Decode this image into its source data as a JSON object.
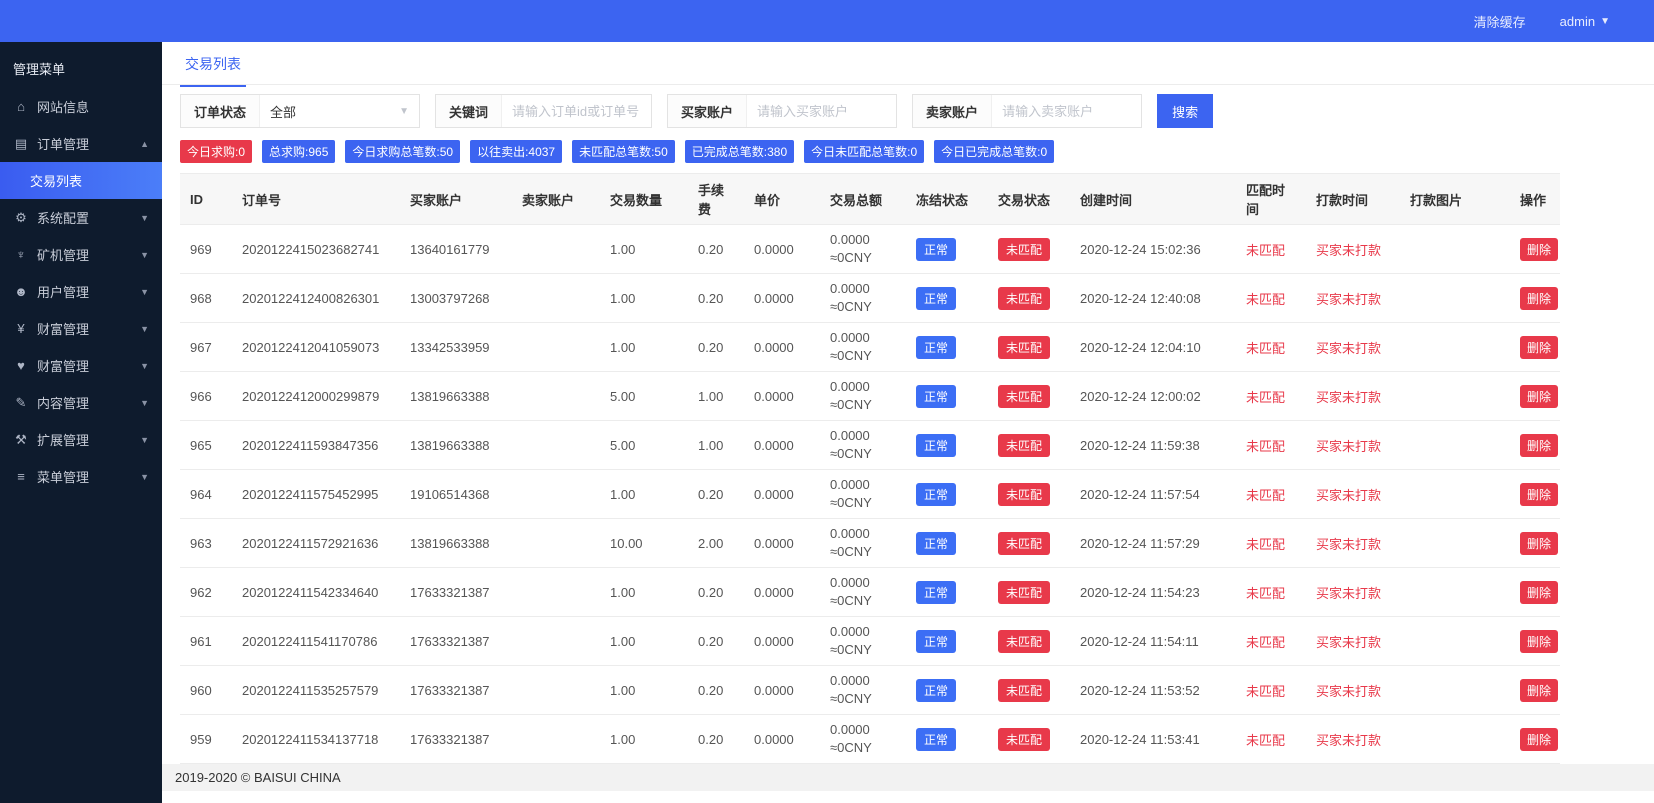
{
  "colors": {
    "primary_blue": "#3c64f1",
    "badge_red": "#e8394a",
    "sidebar_bg": "#0e1b2d"
  },
  "topbar": {
    "clear_cache": "清除缓存",
    "username": "admin"
  },
  "sidebar": {
    "header": "管理菜单",
    "items": [
      {
        "key": "website-info",
        "label": "网站信息",
        "icon": "home-icon"
      },
      {
        "key": "order-management",
        "label": "订单管理",
        "icon": "orders-icon",
        "arrow": "up"
      },
      {
        "key": "trade-list",
        "label": "交易列表",
        "submenu": true,
        "active": true
      },
      {
        "key": "system-config",
        "label": "系统配置",
        "icon": "gear-icon",
        "arrow": "down"
      },
      {
        "key": "miner-management",
        "label": "矿机管理",
        "icon": "miner-icon",
        "arrow": "down"
      },
      {
        "key": "user-management",
        "label": "用户管理",
        "icon": "users-icon",
        "arrow": "down"
      },
      {
        "key": "wealth-management",
        "label": "财富管理",
        "icon": "money-icon",
        "arrow": "down"
      },
      {
        "key": "wealth-management-2",
        "label": "财富管理",
        "icon": "heart-icon",
        "arrow": "down"
      },
      {
        "key": "content-management",
        "label": "内容管理",
        "icon": "document-icon",
        "arrow": "down"
      },
      {
        "key": "extension-management",
        "label": "扩展管理",
        "icon": "wrench-icon",
        "arrow": "down"
      },
      {
        "key": "menu-management",
        "label": "菜单管理",
        "icon": "menu-icon",
        "arrow": "down"
      }
    ]
  },
  "tabs": {
    "active": "交易列表"
  },
  "filters": {
    "order_status": {
      "label": "订单状态",
      "value": "全部"
    },
    "keyword": {
      "label": "关键词",
      "placeholder": "请输入订单id或订单号"
    },
    "buyer": {
      "label": "买家账户",
      "placeholder": "请输入买家账户"
    },
    "seller": {
      "label": "卖家账户",
      "placeholder": "请输入卖家账户"
    },
    "search_button": "搜索"
  },
  "stats": [
    {
      "label": "今日求购:0",
      "color": "red"
    },
    {
      "label": "总求购:965",
      "color": "blue"
    },
    {
      "label": "今日求购总笔数:50",
      "color": "blue"
    },
    {
      "label": "以往卖出:4037",
      "color": "blue"
    },
    {
      "label": "未匹配总笔数:50",
      "color": "blue"
    },
    {
      "label": "已完成总笔数:380",
      "color": "blue"
    },
    {
      "label": "今日未匹配总笔数:0",
      "color": "blue"
    },
    {
      "label": "今日已完成总笔数:0",
      "color": "blue"
    }
  ],
  "table": {
    "columns": [
      "ID",
      "订单号",
      "买家账户",
      "卖家账户",
      "交易数量",
      "手续费",
      "单价",
      "交易总额",
      "冻结状态",
      "交易状态",
      "创建时间",
      "匹配时间",
      "打款时间",
      "打款图片",
      "操作"
    ],
    "action_label": "删除",
    "rows": [
      {
        "id": "969",
        "order_no": "2020122415023682741",
        "buyer": "13640161779",
        "seller": "",
        "qty": "1.00",
        "fee": "0.20",
        "price": "0.0000",
        "total_line1": "0.0000",
        "total_line2": "≈0CNY",
        "freeze_status": "正常",
        "trade_status": "未匹配",
        "created": "2020-12-24 15:02:36",
        "match_time": "未匹配",
        "pay_time": "买家未打款",
        "pay_image": ""
      },
      {
        "id": "968",
        "order_no": "2020122412400826301",
        "buyer": "13003797268",
        "seller": "",
        "qty": "1.00",
        "fee": "0.20",
        "price": "0.0000",
        "total_line1": "0.0000",
        "total_line2": "≈0CNY",
        "freeze_status": "正常",
        "trade_status": "未匹配",
        "created": "2020-12-24 12:40:08",
        "match_time": "未匹配",
        "pay_time": "买家未打款",
        "pay_image": ""
      },
      {
        "id": "967",
        "order_no": "2020122412041059073",
        "buyer": "13342533959",
        "seller": "",
        "qty": "1.00",
        "fee": "0.20",
        "price": "0.0000",
        "total_line1": "0.0000",
        "total_line2": "≈0CNY",
        "freeze_status": "正常",
        "trade_status": "未匹配",
        "created": "2020-12-24 12:04:10",
        "match_time": "未匹配",
        "pay_time": "买家未打款",
        "pay_image": ""
      },
      {
        "id": "966",
        "order_no": "2020122412000299879",
        "buyer": "13819663388",
        "seller": "",
        "qty": "5.00",
        "fee": "1.00",
        "price": "0.0000",
        "total_line1": "0.0000",
        "total_line2": "≈0CNY",
        "freeze_status": "正常",
        "trade_status": "未匹配",
        "created": "2020-12-24 12:00:02",
        "match_time": "未匹配",
        "pay_time": "买家未打款",
        "pay_image": ""
      },
      {
        "id": "965",
        "order_no": "2020122411593847356",
        "buyer": "13819663388",
        "seller": "",
        "qty": "5.00",
        "fee": "1.00",
        "price": "0.0000",
        "total_line1": "0.0000",
        "total_line2": "≈0CNY",
        "freeze_status": "正常",
        "trade_status": "未匹配",
        "created": "2020-12-24 11:59:38",
        "match_time": "未匹配",
        "pay_time": "买家未打款",
        "pay_image": ""
      },
      {
        "id": "964",
        "order_no": "2020122411575452995",
        "buyer": "19106514368",
        "seller": "",
        "qty": "1.00",
        "fee": "0.20",
        "price": "0.0000",
        "total_line1": "0.0000",
        "total_line2": "≈0CNY",
        "freeze_status": "正常",
        "trade_status": "未匹配",
        "created": "2020-12-24 11:57:54",
        "match_time": "未匹配",
        "pay_time": "买家未打款",
        "pay_image": ""
      },
      {
        "id": "963",
        "order_no": "2020122411572921636",
        "buyer": "13819663388",
        "seller": "",
        "qty": "10.00",
        "fee": "2.00",
        "price": "0.0000",
        "total_line1": "0.0000",
        "total_line2": "≈0CNY",
        "freeze_status": "正常",
        "trade_status": "未匹配",
        "created": "2020-12-24 11:57:29",
        "match_time": "未匹配",
        "pay_time": "买家未打款",
        "pay_image": ""
      },
      {
        "id": "962",
        "order_no": "2020122411542334640",
        "buyer": "17633321387",
        "seller": "",
        "qty": "1.00",
        "fee": "0.20",
        "price": "0.0000",
        "total_line1": "0.0000",
        "total_line2": "≈0CNY",
        "freeze_status": "正常",
        "trade_status": "未匹配",
        "created": "2020-12-24 11:54:23",
        "match_time": "未匹配",
        "pay_time": "买家未打款",
        "pay_image": ""
      },
      {
        "id": "961",
        "order_no": "2020122411541170786",
        "buyer": "17633321387",
        "seller": "",
        "qty": "1.00",
        "fee": "0.20",
        "price": "0.0000",
        "total_line1": "0.0000",
        "total_line2": "≈0CNY",
        "freeze_status": "正常",
        "trade_status": "未匹配",
        "created": "2020-12-24 11:54:11",
        "match_time": "未匹配",
        "pay_time": "买家未打款",
        "pay_image": ""
      },
      {
        "id": "960",
        "order_no": "2020122411535257579",
        "buyer": "17633321387",
        "seller": "",
        "qty": "1.00",
        "fee": "0.20",
        "price": "0.0000",
        "total_line1": "0.0000",
        "total_line2": "≈0CNY",
        "freeze_status": "正常",
        "trade_status": "未匹配",
        "created": "2020-12-24 11:53:52",
        "match_time": "未匹配",
        "pay_time": "买家未打款",
        "pay_image": ""
      },
      {
        "id": "959",
        "order_no": "2020122411534137718",
        "buyer": "17633321387",
        "seller": "",
        "qty": "1.00",
        "fee": "0.20",
        "price": "0.0000",
        "total_line1": "0.0000",
        "total_line2": "≈0CNY",
        "freeze_status": "正常",
        "trade_status": "未匹配",
        "created": "2020-12-24 11:53:41",
        "match_time": "未匹配",
        "pay_time": "买家未打款",
        "pay_image": ""
      }
    ]
  },
  "footer": {
    "copyright": "2019-2020 © BAISUI CHINA"
  }
}
